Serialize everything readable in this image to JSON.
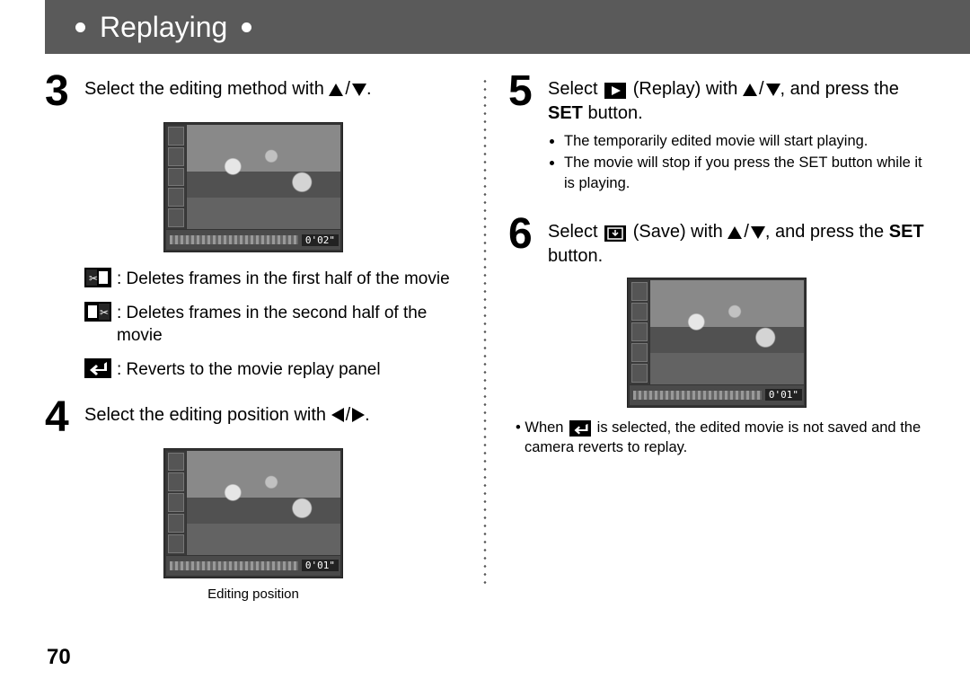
{
  "header": {
    "title": "Replaying"
  },
  "page_number": "70",
  "steps": {
    "s3": {
      "num": "3",
      "text": "Select the editing method with "
    },
    "s4": {
      "num": "4",
      "text": "Select the editing position with "
    },
    "s5": {
      "num": "5",
      "text_a": "Select ",
      "text_b": " (Replay) with ",
      "text_c": ", and press the ",
      "bold": "SET",
      "text_d": " button.",
      "bullets": [
        "The temporarily edited movie will start playing.",
        "The movie will stop if you press the SET button while it is playing."
      ]
    },
    "s6": {
      "num": "6",
      "text_a": "Select ",
      "text_b": " (Save) with ",
      "text_c": ", and press the ",
      "bold": "SET",
      "text_d": " button.",
      "note_a": "When ",
      "note_b": " is selected, the edited movie is not saved and the camera reverts to replay."
    }
  },
  "legend": {
    "cut_first": ": Deletes frames in the first half of the movie",
    "cut_second": ": Deletes frames in the second half of the movie",
    "revert": ": Reverts to the movie replay panel"
  },
  "screenshots": {
    "a_time": "0'02\"",
    "b_time": "0'01\"",
    "c_time": "0'01\"",
    "b_caption": "Editing position"
  }
}
